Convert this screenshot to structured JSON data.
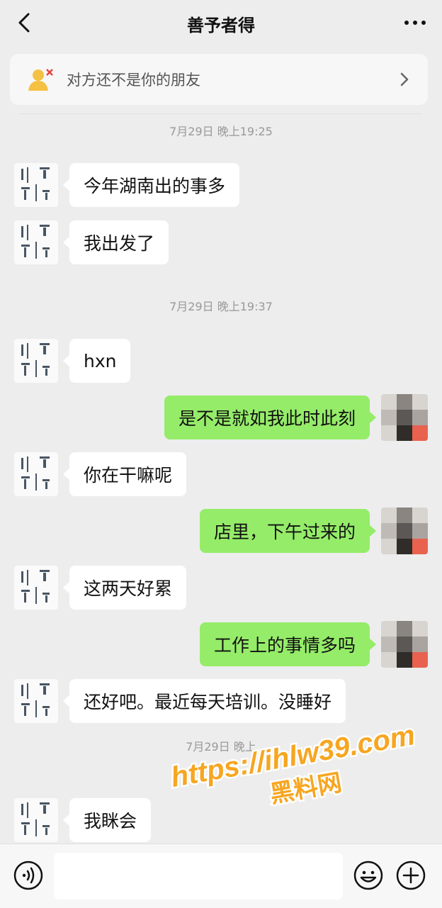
{
  "header": {
    "title": "善予者得"
  },
  "notice": {
    "text": "对方还不是你的朋友"
  },
  "messages": [
    {
      "time": "7月29日 晚上19:25"
    },
    {
      "text": "今年湖南出的事多"
    },
    {
      "text": "我出发了"
    },
    {
      "time": "7月29日 晚上19:37"
    },
    {
      "text": "hxn"
    },
    {
      "text": "是不是就如我此时此刻"
    },
    {
      "text": "你在干嘛呢"
    },
    {
      "text": "店里，下午过来的"
    },
    {
      "text": "这两天好累"
    },
    {
      "text": "工作上的事情多吗"
    },
    {
      "text": "还好吧。最近每天培训。没睡好"
    },
    {
      "time": "7月29日 晚上"
    },
    {
      "text": "我眯会"
    }
  ],
  "watermark": {
    "line1": "https://ihlw39.com",
    "line2": "黑料网"
  },
  "colors": {
    "incoming": "#ffffff",
    "outgoing": "#95ec69",
    "background": "#ededed"
  }
}
